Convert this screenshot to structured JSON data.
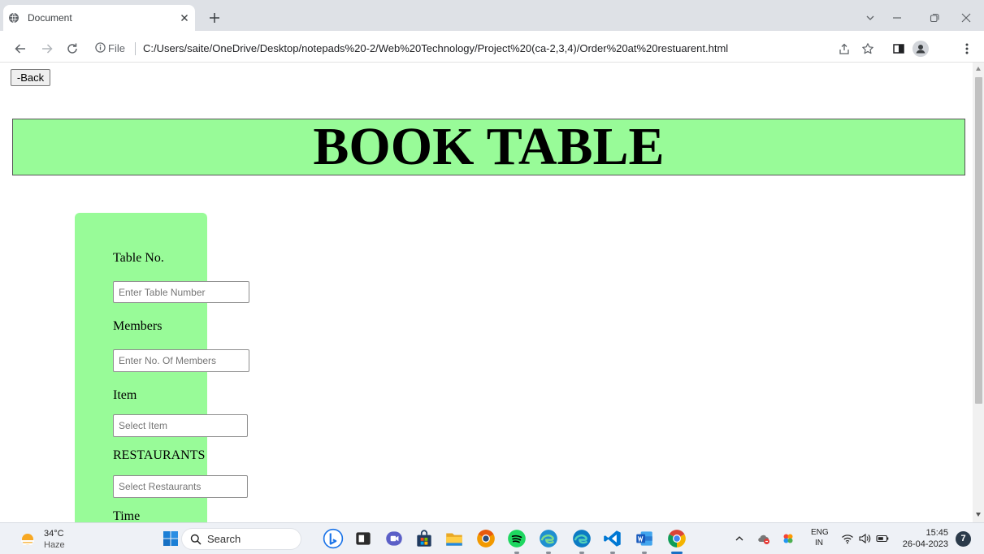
{
  "browser": {
    "tab": {
      "title": "Document"
    },
    "address": {
      "scheme_label": "File",
      "url": "C:/Users/saite/OneDrive/Desktop/notepads%20-2/Web%20Technology/Project%20(ca-2,3,4)/Order%20at%20restuarent.html"
    },
    "icons": {
      "tab": [
        "globe-icon",
        "tab-close-icon",
        "new-tab-icon"
      ],
      "window": [
        "tab-search-chevron-icon",
        "minimize-icon",
        "restore-icon",
        "close-window-icon"
      ],
      "toolbar": [
        "back-arrow-icon",
        "forward-arrow-icon",
        "reload-icon",
        "site-info-icon",
        "share-icon",
        "bookmark-star-icon",
        "side-panel-icon",
        "profile-icon",
        "menu-dots-icon"
      ]
    }
  },
  "page": {
    "back_button": "-Back",
    "banner_title": "BOOK TABLE",
    "form_fields": [
      {
        "label": "Table No.",
        "placeholder": "Enter Table Number"
      },
      {
        "label": "Members",
        "placeholder": "Enter No. Of Members"
      },
      {
        "label": "Item",
        "placeholder": "Select Item"
      },
      {
        "label": "RESTAURANTS",
        "placeholder": "Select Restaurants"
      },
      {
        "label": "Time"
      }
    ]
  },
  "taskbar": {
    "weather": {
      "temperature": "34°C",
      "condition": "Haze"
    },
    "search_label": "Search",
    "apps": [
      "bing-icon",
      "task-view-icon",
      "meet-icon",
      "store-icon",
      "file-explorer-icon",
      "chrome-canary-icon",
      "spotify-icon",
      "edge-beta-icon",
      "edge-icon",
      "vscode-icon",
      "word-icon",
      "chrome-icon"
    ],
    "tray_icons": [
      "chevron-up-icon",
      "cloud-status-icon",
      "colorful-app-icon",
      "wifi-icon",
      "volume-icon",
      "battery-icon"
    ],
    "language": {
      "code": "ENG",
      "region": "IN"
    },
    "clock": {
      "time": "15:45",
      "date": "26-04-2023"
    },
    "notification_count": "7"
  },
  "colors": {
    "banner_bg": "#98fb98",
    "panel_bg": "#98fb98",
    "tabstrip_bg": "#dee1e6",
    "taskbar_bg": "#eef1f6"
  }
}
